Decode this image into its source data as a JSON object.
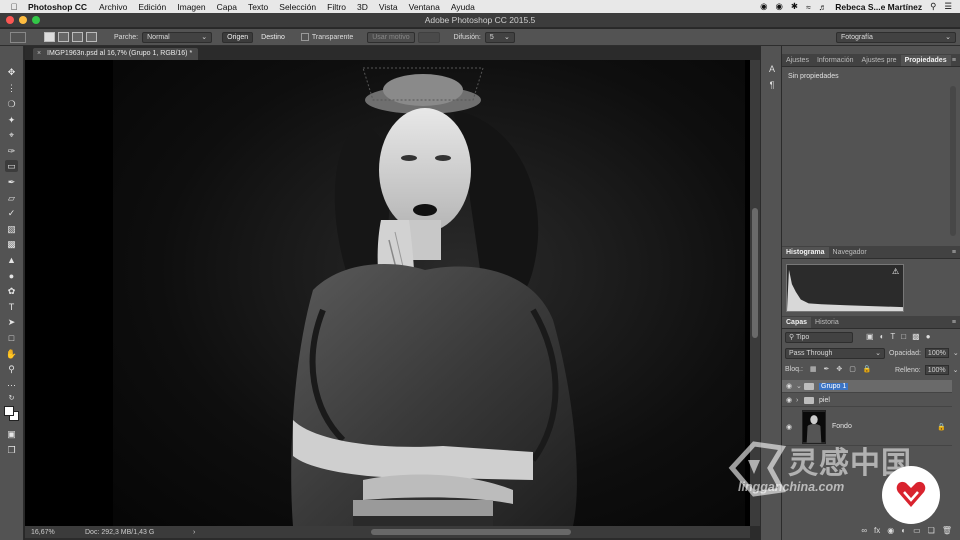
{
  "menubar": {
    "app": "Photoshop CC",
    "items": [
      "Archivo",
      "Edición",
      "Imagen",
      "Capa",
      "Texto",
      "Selección",
      "Filtro",
      "3D",
      "Vista",
      "Ventana",
      "Ayuda"
    ],
    "user": "Rebeca S...e Martínez"
  },
  "window": {
    "title": "Adobe Photoshop CC 2015.5"
  },
  "options": {
    "patch_label": "Parche:",
    "patch_value": "Normal",
    "source_btn": "Origen",
    "dest_btn": "Destino",
    "transparent_label": "Transparente",
    "use_pattern_btn": "Usar motivo",
    "diffusion_label": "Difusión:",
    "diffusion_value": "5",
    "workspace_value": "Fotografía"
  },
  "document": {
    "tab_title": "IMGP1963n.psd al 16,7% (Grupo 1, RGB/16) *",
    "zoom": "16,67%",
    "doc_info": "Doc: 292,3 MB/1,43 G",
    "arrow": "›"
  },
  "properties_panel": {
    "tabs": [
      "Ajustes",
      "Información",
      "Ajustes pre",
      "Propiedades"
    ],
    "active_tab": "Propiedades",
    "body_text": "Sin propiedades"
  },
  "histogram_panel": {
    "tabs": [
      "Histograma",
      "Navegador"
    ],
    "active_tab": "Histograma"
  },
  "layers_panel": {
    "tabs": [
      "Capas",
      "Historia"
    ],
    "active_tab": "Capas",
    "kind_filter": "Tipo",
    "blend_mode": "Pass Through",
    "opacity_label": "Opacidad:",
    "opacity_value": "100%",
    "lock_label": "Bloq.:",
    "fill_label": "Relleno:",
    "fill_value": "100%",
    "layers": [
      {
        "name": "Grupo 1",
        "type": "group",
        "selected": true,
        "expanded": true
      },
      {
        "name": "piel",
        "type": "group",
        "selected": false,
        "expanded": false
      },
      {
        "name": "Fondo",
        "type": "image",
        "selected": false,
        "locked": true
      }
    ]
  },
  "watermark": {
    "chinese_text": "灵感中国",
    "site_text": "lingganchina.com"
  },
  "colors": {
    "accent_selection": "#3b74c4",
    "panel_bg": "#535353",
    "canvas_bg": "#000000",
    "traffic_red": "#fc5753",
    "traffic_yellow": "#fdbc40",
    "traffic_green": "#33c748",
    "watermark_red": "#d9232e"
  }
}
